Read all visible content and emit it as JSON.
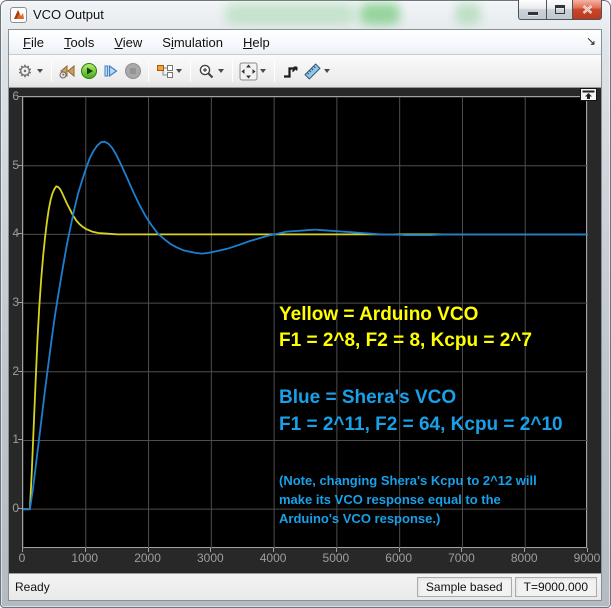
{
  "window": {
    "title": "VCO Output",
    "controls": {
      "minimize": "minimize",
      "maximize": "maximize",
      "close": "close"
    }
  },
  "menu": {
    "items": [
      {
        "name": "file",
        "label": "File",
        "underline": 0
      },
      {
        "name": "tools",
        "label": "Tools",
        "underline": 0
      },
      {
        "name": "view",
        "label": "View",
        "underline": 0
      },
      {
        "name": "simulation",
        "label": "Simulation",
        "underline": 1
      },
      {
        "name": "help",
        "label": "Help",
        "underline": 0
      }
    ],
    "dock_arrow_icon": "↘"
  },
  "toolbar": {
    "icons": [
      "settings-gear",
      "step-back",
      "run",
      "step-forward",
      "stop",
      "signal-selector",
      "zoom-in",
      "fit-to-view",
      "trigger",
      "measurements"
    ]
  },
  "status": {
    "ready": "Ready",
    "sample_mode": "Sample based",
    "time": "T=9000.000"
  },
  "chart_data": {
    "type": "line",
    "title": "",
    "xlabel": "",
    "ylabel": "",
    "xlim": [
      0,
      9000
    ],
    "ylim": [
      -0.58,
      6
    ],
    "xticks": [
      0,
      1000,
      2000,
      3000,
      4000,
      5000,
      6000,
      7000,
      8000,
      9000
    ],
    "yticks": [
      0,
      1,
      2,
      3,
      4,
      5,
      6
    ],
    "grid": true,
    "legend_position": "none",
    "colors": {
      "plot_bg": "#000000",
      "outer_bg": "#282828",
      "gridline": "#4e4e4e",
      "axis_border": "#a2a2a2",
      "tick_label": "#9e9e9e"
    },
    "series": [
      {
        "name": "Arduino VCO",
        "color": "#d6d41f",
        "points": [
          [
            0,
            0
          ],
          [
            110,
            0
          ],
          [
            140,
            0.55
          ],
          [
            170,
            1.2
          ],
          [
            200,
            1.85
          ],
          [
            230,
            2.45
          ],
          [
            260,
            2.95
          ],
          [
            290,
            3.35
          ],
          [
            320,
            3.68
          ],
          [
            350,
            3.95
          ],
          [
            380,
            4.18
          ],
          [
            410,
            4.36
          ],
          [
            440,
            4.5
          ],
          [
            470,
            4.6
          ],
          [
            500,
            4.66
          ],
          [
            530,
            4.7
          ],
          [
            560,
            4.69
          ],
          [
            590,
            4.66
          ],
          [
            620,
            4.61
          ],
          [
            660,
            4.53
          ],
          [
            700,
            4.45
          ],
          [
            750,
            4.36
          ],
          [
            800,
            4.27
          ],
          [
            850,
            4.2
          ],
          [
            900,
            4.15
          ],
          [
            950,
            4.11
          ],
          [
            1000,
            4.08
          ],
          [
            1100,
            4.04
          ],
          [
            1200,
            4.02
          ],
          [
            1350,
            4.01
          ],
          [
            1500,
            4.0
          ],
          [
            1700,
            4.0
          ],
          [
            2000,
            4.0
          ],
          [
            2500,
            4.0
          ],
          [
            3000,
            4.0
          ],
          [
            3500,
            4.0
          ],
          [
            4000,
            4.0
          ],
          [
            5000,
            4.0
          ],
          [
            6000,
            4.0
          ],
          [
            7000,
            4.0
          ],
          [
            8000,
            4.0
          ],
          [
            9000,
            4.0
          ]
        ]
      },
      {
        "name": "Shera's VCO",
        "color": "#1e7fd0",
        "points": [
          [
            0,
            0
          ],
          [
            110,
            0
          ],
          [
            160,
            0.3
          ],
          [
            220,
            0.75
          ],
          [
            280,
            1.2
          ],
          [
            340,
            1.65
          ],
          [
            400,
            2.08
          ],
          [
            460,
            2.5
          ],
          [
            520,
            2.88
          ],
          [
            580,
            3.22
          ],
          [
            640,
            3.55
          ],
          [
            700,
            3.85
          ],
          [
            760,
            4.12
          ],
          [
            820,
            4.38
          ],
          [
            880,
            4.6
          ],
          [
            940,
            4.78
          ],
          [
            1000,
            4.95
          ],
          [
            1060,
            5.1
          ],
          [
            1120,
            5.21
          ],
          [
            1180,
            5.29
          ],
          [
            1240,
            5.34
          ],
          [
            1300,
            5.35
          ],
          [
            1360,
            5.32
          ],
          [
            1420,
            5.26
          ],
          [
            1480,
            5.17
          ],
          [
            1560,
            5.02
          ],
          [
            1650,
            4.84
          ],
          [
            1750,
            4.63
          ],
          [
            1850,
            4.44
          ],
          [
            1950,
            4.27
          ],
          [
            2050,
            4.13
          ],
          [
            2150,
            4.01
          ],
          [
            2250,
            3.93
          ],
          [
            2350,
            3.86
          ],
          [
            2450,
            3.81
          ],
          [
            2550,
            3.77
          ],
          [
            2650,
            3.75
          ],
          [
            2750,
            3.73
          ],
          [
            2850,
            3.72
          ],
          [
            2950,
            3.73
          ],
          [
            3050,
            3.75
          ],
          [
            3150,
            3.77
          ],
          [
            3250,
            3.79
          ],
          [
            3350,
            3.82
          ],
          [
            3450,
            3.85
          ],
          [
            3600,
            3.9
          ],
          [
            3750,
            3.94
          ],
          [
            3900,
            3.98
          ],
          [
            4050,
            4.01
          ],
          [
            4200,
            4.04
          ],
          [
            4350,
            4.05
          ],
          [
            4500,
            4.06
          ],
          [
            4650,
            4.07
          ],
          [
            4800,
            4.06
          ],
          [
            4950,
            4.05
          ],
          [
            5100,
            4.04
          ],
          [
            5250,
            4.03
          ],
          [
            5400,
            4.02
          ],
          [
            5550,
            4.01
          ],
          [
            5700,
            4.0
          ],
          [
            5900,
            4.0
          ],
          [
            6100,
            3.99
          ],
          [
            6300,
            3.99
          ],
          [
            6500,
            3.99
          ],
          [
            6700,
            4.0
          ],
          [
            6900,
            4.0
          ],
          [
            7200,
            4.0
          ],
          [
            7500,
            4.0
          ],
          [
            8000,
            4.0
          ],
          [
            8500,
            4.0
          ],
          [
            9000,
            4.0
          ]
        ]
      }
    ],
    "annotations": [
      {
        "id": "yellow-label",
        "color": "#ffff00",
        "x": 256,
        "y": 205,
        "font": 19,
        "lh": 26,
        "text": "Yellow = Arduino VCO\nF1 = 2^8, F2 = 8, Kcpu = 2^7"
      },
      {
        "id": "blue-label",
        "color": "#18a0e8",
        "x": 256,
        "y": 287,
        "font": 19,
        "lh": 27,
        "text": "Blue = Shera's VCO\nF1 = 2^11, F2 = 64, Kcpu = 2^10"
      },
      {
        "id": "note-label",
        "color": "#18a0e8",
        "x": 256,
        "y": 374,
        "font": 13,
        "lh": 19,
        "text": "(Note, changing Shera's Kcpu to 2^12 will\nmake its VCO response equal to the\nArduino's VCO response.)"
      }
    ]
  }
}
